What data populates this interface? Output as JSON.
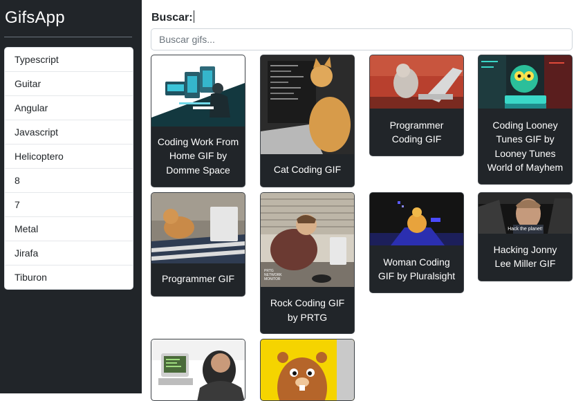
{
  "app": {
    "title": "GifsApp"
  },
  "sidebar": {
    "history": [
      "Typescript",
      "Guitar",
      "Angular",
      "Javascript",
      "Helicoptero",
      "8",
      "7",
      "Metal",
      "Jirafa",
      "Tiburon"
    ]
  },
  "search": {
    "label": "Buscar:",
    "placeholder": "Buscar gifs...",
    "value": ""
  },
  "results": [
    {
      "title": "Coding Work From Home GIF by Domme Space"
    },
    {
      "title": "Cat Coding GIF"
    },
    {
      "title": "Programmer Coding GIF"
    },
    {
      "title": "Coding Looney Tunes GIF by Looney Tunes World of Mayhem"
    },
    {
      "title": "Programmer GIF"
    },
    {
      "title": "Rock Coding GIF by PRTG"
    },
    {
      "title": "Woman Coding GIF by Pluralsight"
    },
    {
      "title": "Hacking Jonny Lee Miller GIF"
    },
    {
      "title": ""
    },
    {
      "title": ""
    }
  ],
  "image_text": {
    "hack_the_planet": "Hack the planet!",
    "prtg_logo": "PRTG NETWORK MONITOR"
  },
  "colors": {
    "sidebar_bg": "#212529",
    "card_bg": "#212529",
    "accent_orange": "#e8a33c"
  }
}
